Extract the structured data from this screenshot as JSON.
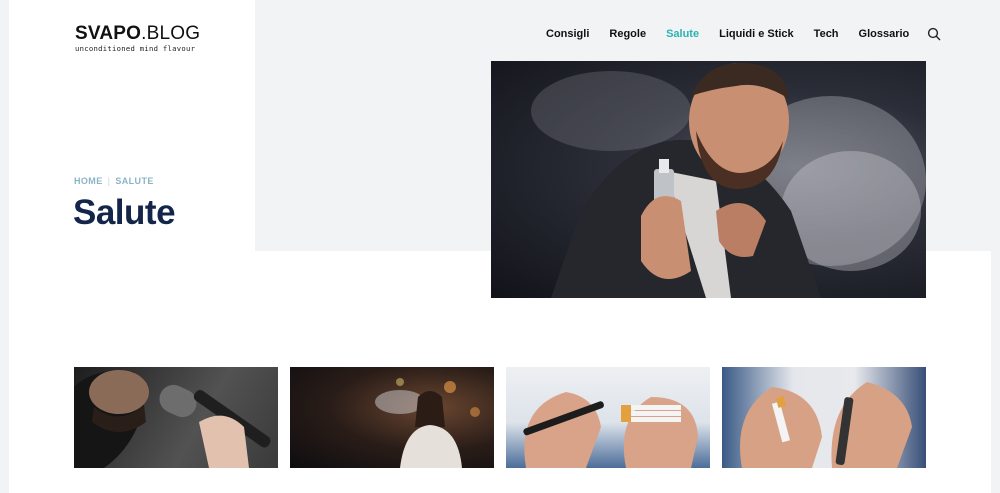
{
  "logo": {
    "brand_bold": "SVAPO",
    "brand_light": ".BLOG",
    "tagline": "unconditioned mind flavour"
  },
  "nav": {
    "items": [
      {
        "label": "Consigli"
      },
      {
        "label": "Regole"
      },
      {
        "label": "Salute",
        "active": true
      },
      {
        "label": "Liquidi e Stick"
      },
      {
        "label": "Tech"
      },
      {
        "label": "Glossario"
      }
    ],
    "accent_color": "#2bb3b1",
    "search_icon": "search-icon"
  },
  "breadcrumb": {
    "home": "HOME",
    "current": "SALUTE"
  },
  "page": {
    "title": "Salute",
    "title_color": "#14254a"
  },
  "hero_image": {
    "subject": "man exhaling vape smoke"
  },
  "thumbnails": [
    {
      "subject": "man with microphone"
    },
    {
      "subject": "woman vaping at night"
    },
    {
      "subject": "hands holding e-cigarette and cigarettes"
    },
    {
      "subject": "hands holding broken cigarette and vape"
    }
  ]
}
